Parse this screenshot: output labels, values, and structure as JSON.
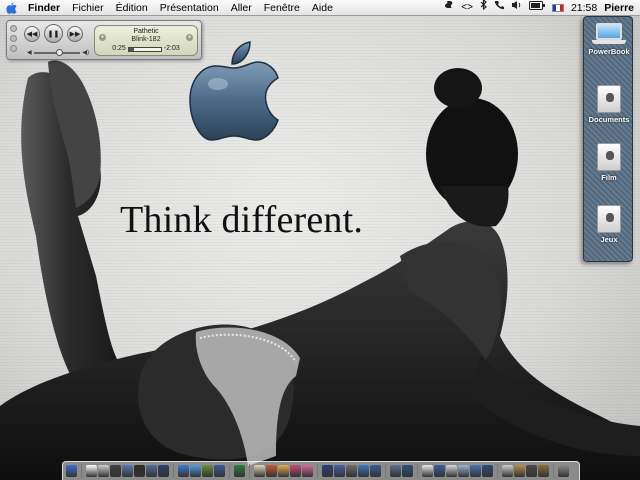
{
  "menubar": {
    "apple_menu": "apple-icon",
    "items": [
      {
        "label": "Finder",
        "bold": true
      },
      {
        "label": "Fichier"
      },
      {
        "label": "Édition"
      },
      {
        "label": "Présentation"
      },
      {
        "label": "Aller"
      },
      {
        "label": "Fenêtre"
      },
      {
        "label": "Aide"
      }
    ],
    "extras": {
      "icons": [
        "script-menu-icon",
        "displays-icon",
        "bluetooth-icon",
        "modem-icon",
        "volume-icon",
        "battery-icon",
        "flag-fr-icon"
      ],
      "clock": "21:58",
      "user": "Pierre"
    }
  },
  "player": {
    "track_title": "Pathetic",
    "track_artist": "Blink-182",
    "elapsed": "0:25",
    "remaining": "-2:03",
    "progress": 0.17,
    "volume": 0.55
  },
  "desktop": {
    "tagline": "Think different."
  },
  "drawer": {
    "items": [
      {
        "label": "PowerBook",
        "icon": "powerbook-icon"
      },
      {
        "label": "Documents",
        "icon": "hard-drive-icon"
      },
      {
        "label": "Film",
        "icon": "hard-drive-icon"
      },
      {
        "label": "Jeux",
        "icon": "hard-drive-icon"
      }
    ]
  },
  "dock": {
    "groups": [
      [
        "#3a6fd6"
      ],
      [
        "#ffffff",
        "#cfcfcf",
        "#404040",
        "#5a78b0",
        "#2c2c2c",
        "#4f6c9a",
        "#2a3f6e"
      ],
      [
        "#3a7bd5",
        "#4fa0e0",
        "#6b8f3a",
        "#3d5c9a"
      ],
      [
        "#2f7d3a"
      ],
      [
        "#e0d6c0",
        "#c45a2e",
        "#e2b04c",
        "#c44c7a",
        "#d86a9a"
      ],
      [
        "#2b3f7a",
        "#4a5fa8",
        "#6c6c6c",
        "#3b78c5",
        "#385d9c"
      ],
      [
        "#5b6f8f",
        "#2c4f86"
      ],
      [
        "#e9e9e9",
        "#3b5ea0",
        "#d8d8d8",
        "#9cb4d8",
        "#4b74b0",
        "#2e4b7e"
      ],
      [
        "#cfcfcf",
        "#b98b4a",
        "#4a4a4a",
        "#8a6f3c"
      ],
      [
        "#8a8a8a"
      ]
    ]
  }
}
